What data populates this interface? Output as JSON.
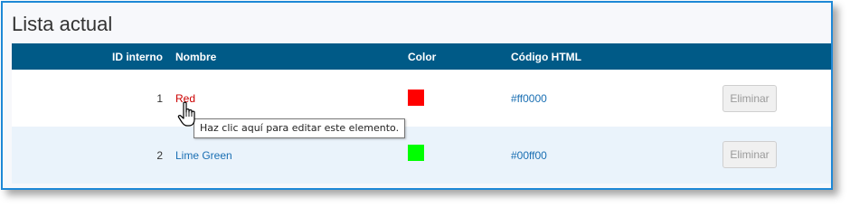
{
  "section_title": "Lista actual",
  "columns": {
    "id": "ID interno",
    "name": "Nombre",
    "color": "Color",
    "code": "Código HTML"
  },
  "rows": [
    {
      "id": "1",
      "name": "Red",
      "color_hex": "#ff0000",
      "code": "#ff0000",
      "delete_label": "Eliminar"
    },
    {
      "id": "2",
      "name": "Lime Green",
      "color_hex": "#00ff00",
      "code": "#00ff00",
      "delete_label": "Eliminar"
    }
  ],
  "tooltip": "Haz clic aquí para editar este elemento.",
  "colors": {
    "header_bg": "#005a87",
    "frame_border": "#1e88d6",
    "link": "#1a6fb3",
    "active_link": "#cc0000",
    "alt_row": "#eaf3fb"
  },
  "icons": {
    "cursor": "hand-pointer-icon"
  }
}
